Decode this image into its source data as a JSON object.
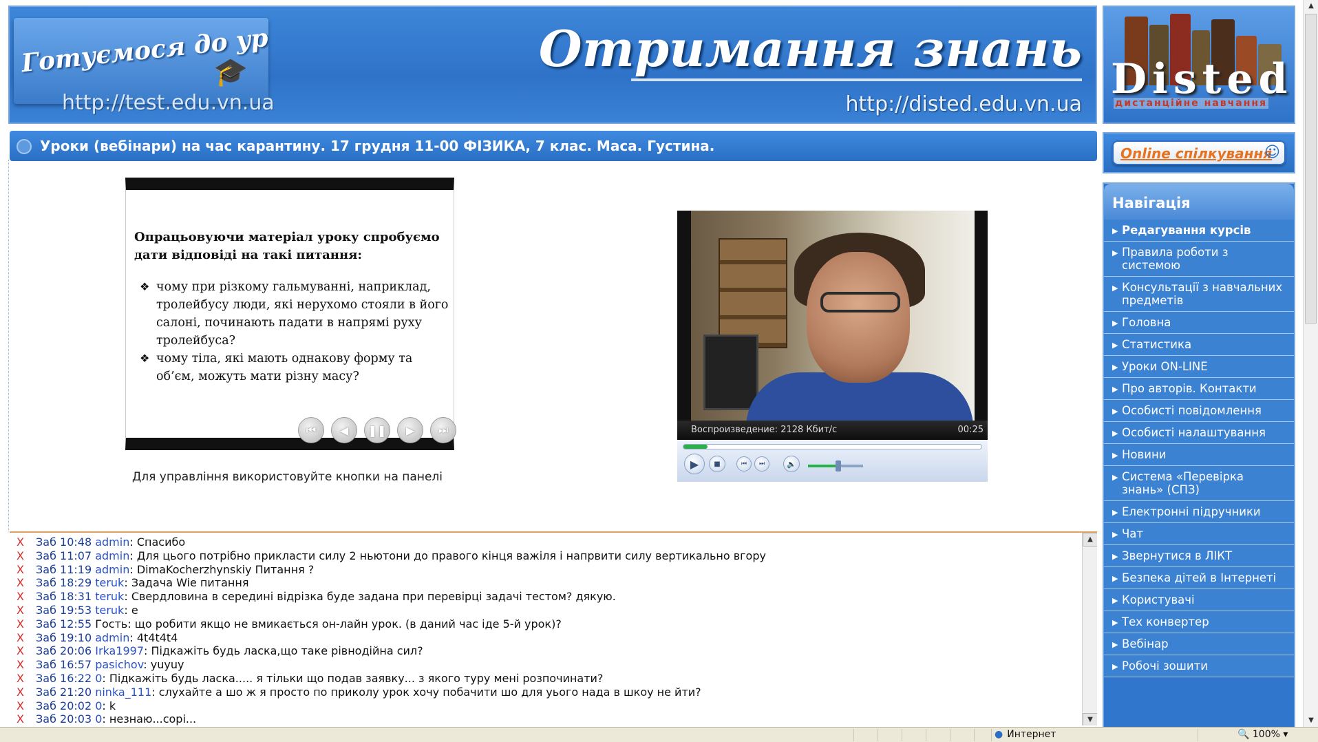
{
  "header": {
    "logo_left_text": "Готуємося до уроків",
    "url_left": "http://test.edu.vn.ua",
    "title": "Отримання знань",
    "url_right": "http://disted.edu.vn.ua",
    "brand": "Disted",
    "brand_subtitle": "дистанційне навчання"
  },
  "news": {
    "text": "Уроки (вебінари) на час карантину. 17 грудня 11-00 ФІЗИКА, 7 клас. Маса. Густина."
  },
  "slide": {
    "heading": "Опрацьовуючи матеріал уроку спробуємо дати відповіді на такі питання:",
    "bullets": [
      "чому при різкому гальмуванні, наприклад, тролейбусу люди, які нерухомо стояли в його салоні, починають падати в напрямі руху тролейбуса?",
      "чому тіла, які мають однакову форму та об’єм, можуть мати різну масу?"
    ],
    "caption": "Для управління використовуйте кнопки на панелі"
  },
  "video": {
    "status": "Воспроизведение: 2128 Кбит/с",
    "time": "00:25",
    "progress": 0.08,
    "volume": 0.55
  },
  "chat": {
    "lines": [
      {
        "x": "X",
        "time": "Заб 10:48",
        "user": "admin",
        "sep": ": ",
        "msg": "Спасибо"
      },
      {
        "x": "X",
        "time": "Заб 11:07",
        "user": "admin",
        "sep": ": ",
        "msg": "Для цього потрібно прикласти силу 2 ньютони до правого кінця важіля і напрвити силу вертикально вгору"
      },
      {
        "x": "X",
        "time": "Заб 11:19",
        "user": "admin",
        "sep": ": ",
        "msg": "DimaKocherzhynskiy Питання ?"
      },
      {
        "x": "X",
        "time": "Заб 18:29",
        "user": "teruk",
        "sep": ": ",
        "msg": "Задача Wie питання"
      },
      {
        "x": "X",
        "time": "Заб 18:31",
        "user": "teruk",
        "sep": ": ",
        "msg": "Свердловина в середині відрізка буде задана при перевірці задачі тестом? дякую."
      },
      {
        "x": "X",
        "time": "Заб 19:53",
        "user": "teruk",
        "sep": ": ",
        "msg": "е"
      },
      {
        "x": "X",
        "time": "Заб 12:55",
        "user": "",
        "sep": "",
        "msg": "Гость: що робити якщо не вмикається он-лайн урок. (в даний час іде 5-й урок)?"
      },
      {
        "x": "X",
        "time": "Заб 19:10",
        "user": "admin",
        "sep": ": ",
        "msg": "4t4t4t4"
      },
      {
        "x": "X",
        "time": "Заб 20:06",
        "user": "Irka1997",
        "sep": ": ",
        "msg": "Підкажіть будь ласка,що таке рівнодійна сил?"
      },
      {
        "x": "X",
        "time": "Заб 16:57",
        "user": "pasichov",
        "sep": ": ",
        "msg": "yuyuy"
      },
      {
        "x": "X",
        "time": "Заб 16:22",
        "user": "0",
        "sep": ": ",
        "msg": "Підкажіть будь ласка..... я тільки що подав заявку... з якого туру мені розпочинати?"
      },
      {
        "x": "X",
        "time": "Заб 21:20",
        "user": "ninka_111",
        "sep": ": ",
        "msg": "слухайте а шо ж я просто по приколу урок хочу побачити шо для уього нада в шкоу не йти?"
      },
      {
        "x": "X",
        "time": "Заб 20:02",
        "user": "0",
        "sep": ": ",
        "msg": "k"
      },
      {
        "x": "X",
        "time": "Заб 20:03",
        "user": "0",
        "sep": ": ",
        "msg": "незнаю...copi..."
      }
    ]
  },
  "sidebar": {
    "online_label": "Online спілкування",
    "nav_title": "Навігація",
    "items": [
      "Редагування курсів",
      "Правила роботи з системою",
      "Консультації з навчальних предметів",
      "Головна",
      "Статистика",
      "Уроки ON-LINE",
      "Про авторів. Контакти",
      "Особисті повідомлення",
      "Особисті налаштування",
      "Новини",
      "Система «Перевірка знань» (СПЗ)",
      "Електронні підручники",
      "Чат",
      "Звернутися в ЛІКТ",
      "Безпека дітей в Інтернеті",
      "Користувачі",
      "Тех конвертер",
      "Вебінар",
      "Робочі зошити"
    ]
  },
  "statusbar": {
    "zone": "Интернет",
    "zoom": "100%"
  },
  "colors": {
    "header_blue": "#2f73c9",
    "nav_blue": "#3c82d3",
    "chat_x": "#d62b2b",
    "chat_user": "#2a52c9",
    "online_orange": "#e8731e"
  }
}
